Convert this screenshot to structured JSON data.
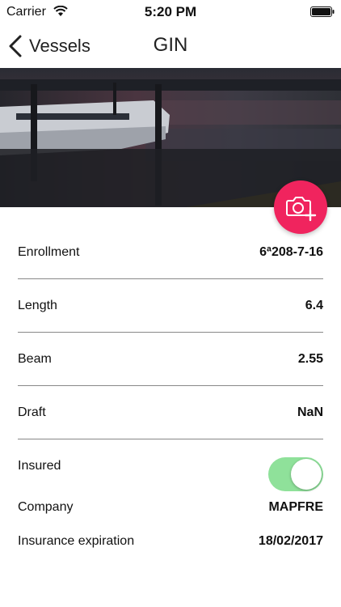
{
  "status_bar": {
    "carrier": "Carrier",
    "time": "5:20 PM"
  },
  "nav": {
    "back_label": "Vessels",
    "title": "GIN"
  },
  "hero": {
    "fab_icon": "camera-add-icon",
    "fab_color": "#f0245e"
  },
  "details": {
    "enrollment": {
      "label": "Enrollment",
      "value": "6ª208-7-16"
    },
    "length": {
      "label": "Length",
      "value": "6.4"
    },
    "beam": {
      "label": "Beam",
      "value": "2.55"
    },
    "draft": {
      "label": "Draft",
      "value": "NaN"
    },
    "insured": {
      "label": "Insured",
      "on": true,
      "toggle_color": "#8fe19a"
    },
    "company": {
      "label": "Company",
      "value": "MAPFRE"
    },
    "insurance_expiration": {
      "label": "Insurance expiration",
      "value": "18/02/2017"
    }
  }
}
